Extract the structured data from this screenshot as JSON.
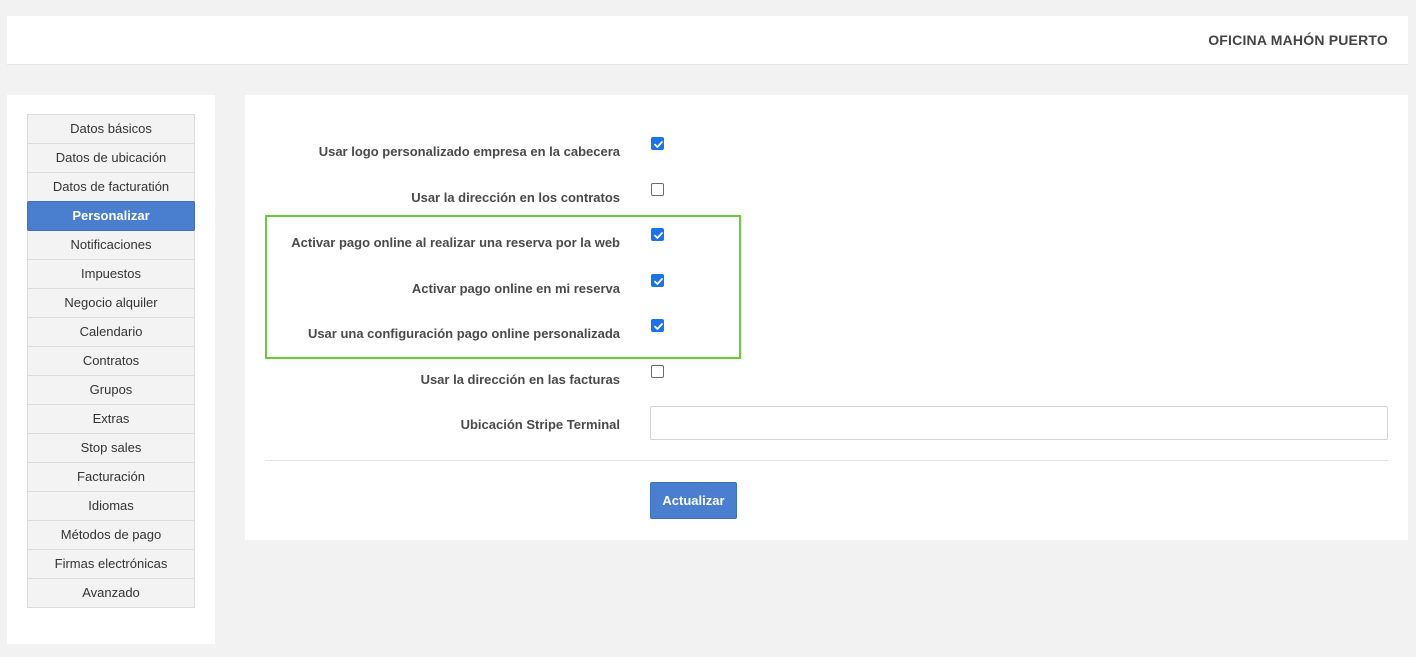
{
  "header": {
    "office_name": "OFICINA MAHÓN PUERTO"
  },
  "sidebar": {
    "items": [
      {
        "label": "Datos básicos",
        "active": false
      },
      {
        "label": "Datos de ubicación",
        "active": false
      },
      {
        "label": "Datos de facturatión",
        "active": false
      },
      {
        "label": "Personalizar",
        "active": true
      },
      {
        "label": "Notificaciones",
        "active": false
      },
      {
        "label": "Impuestos",
        "active": false
      },
      {
        "label": "Negocio alquiler",
        "active": false
      },
      {
        "label": "Calendario",
        "active": false
      },
      {
        "label": "Contratos",
        "active": false
      },
      {
        "label": "Grupos",
        "active": false
      },
      {
        "label": "Extras",
        "active": false
      },
      {
        "label": "Stop sales",
        "active": false
      },
      {
        "label": "Facturación",
        "active": false
      },
      {
        "label": "Idiomas",
        "active": false
      },
      {
        "label": "Métodos de pago",
        "active": false
      },
      {
        "label": "Firmas electrónicas",
        "active": false
      },
      {
        "label": "Avanzado",
        "active": false
      }
    ]
  },
  "form": {
    "options": [
      {
        "label": "Usar logo personalizado empresa en la cabecera",
        "checked": true
      },
      {
        "label": "Usar la dirección en los contratos",
        "checked": false
      },
      {
        "label": "Activar pago online al realizar una reserva por la web",
        "checked": true
      },
      {
        "label": "Activar pago online en mi reserva",
        "checked": true
      },
      {
        "label": "Usar una configuración pago online personalizada",
        "checked": true
      },
      {
        "label": "Usar la dirección en las facturas",
        "checked": false
      }
    ],
    "stripe_label": "Ubicación Stripe Terminal",
    "stripe_value": "",
    "submit_label": "Actualizar"
  },
  "colors": {
    "accent": "#4a7fcf",
    "checkbox": "#1a73e8",
    "highlight_border": "#6acb3b"
  }
}
